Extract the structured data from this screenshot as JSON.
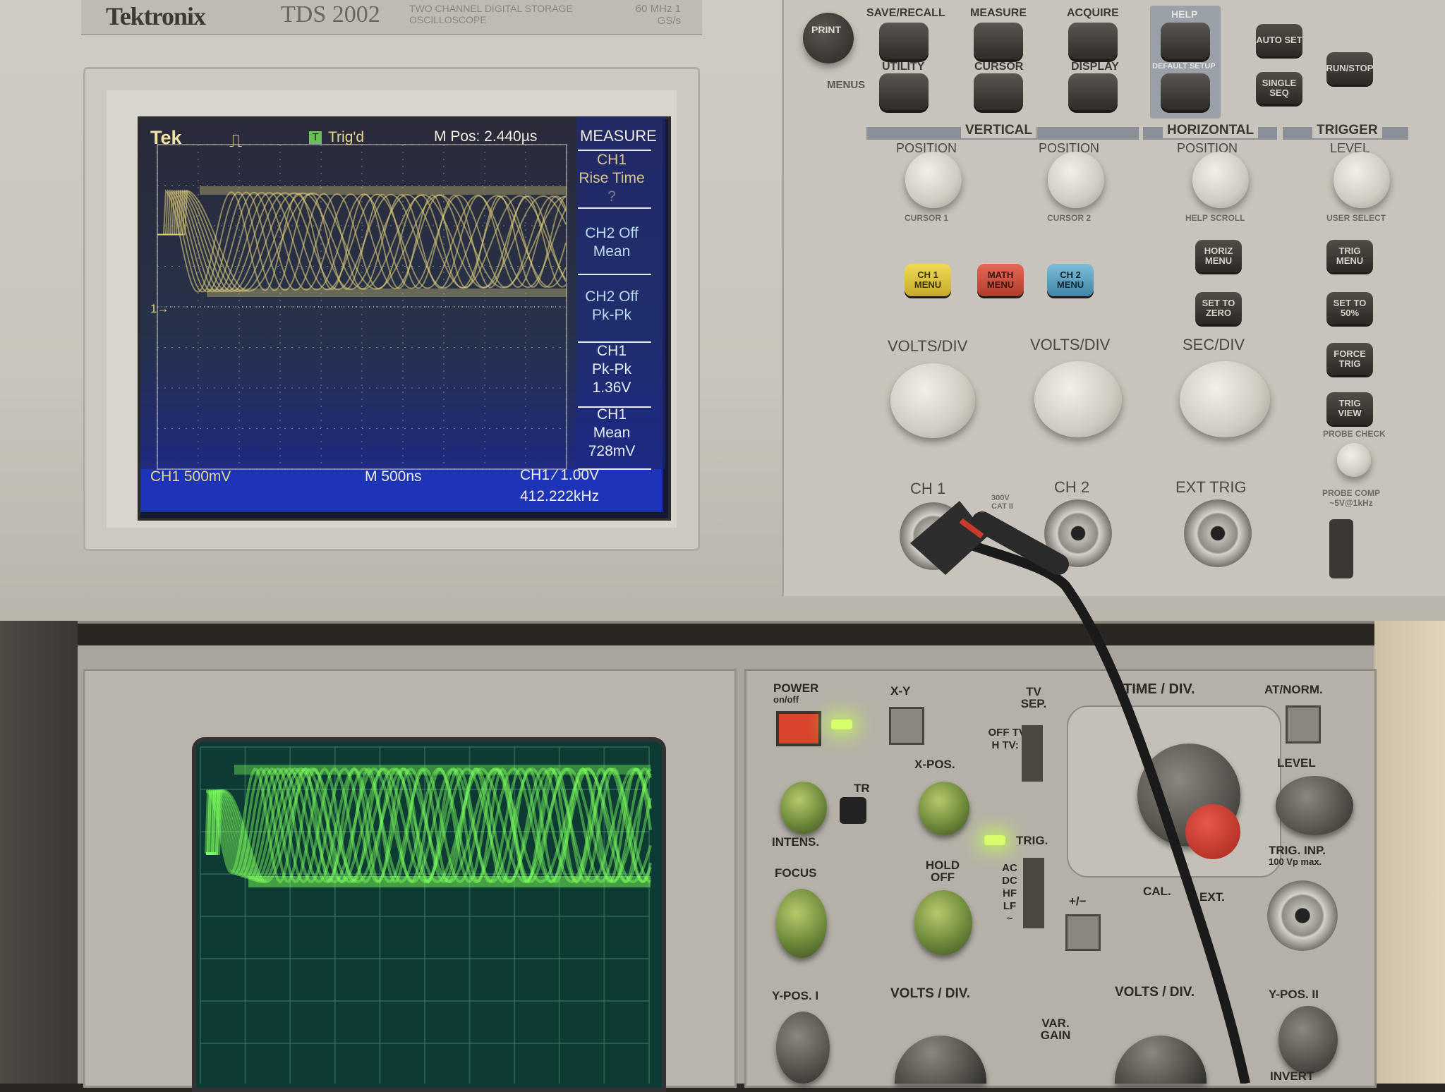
{
  "tds": {
    "brand": "Tektronix",
    "model": "TDS 2002",
    "model_desc": "TWO CHANNEL DIGITAL STORAGE OSCILLOSCOPE",
    "bandwidth": "60 MHz 1 GS/s"
  },
  "lcd": {
    "tek": "Tek",
    "trig_state": "Trig'd",
    "trig_icon": "T",
    "mpos": "M Pos: 2.440µs",
    "ch1_scale": "CH1  500mV",
    "timebase": "M 500ns",
    "trigger": "CH1 ∕ 1.00V",
    "frequency": "412.222kHz",
    "marker": "1→",
    "menu": {
      "title": "MEASURE",
      "slots": [
        {
          "l1": "CH1",
          "l2": "Rise Time",
          "l3": "?"
        },
        {
          "l1": "CH2 Off",
          "l2": "Mean",
          "l3": ""
        },
        {
          "l1": "CH2 Off",
          "l2": "Pk-Pk",
          "l3": ""
        },
        {
          "l1": "CH1",
          "l2": "Pk-Pk",
          "l3": "1.36V"
        },
        {
          "l1": "CH1",
          "l2": "Mean",
          "l3": "728mV"
        }
      ]
    },
    "trace_color": "#e2d27a",
    "screen_bg": "#141832"
  },
  "panel": {
    "print": "PRINT",
    "menus": "MENUS",
    "top_labels": [
      "SAVE/RECALL",
      "MEASURE",
      "ACQUIRE",
      "HELP"
    ],
    "mid_labels": [
      "UTILITY",
      "CURSOR",
      "DISPLAY",
      "DEFAULT SETUP"
    ],
    "autoset": "AUTO SET",
    "run_stop": "RUN/STOP",
    "single_seq": "SINGLE SEQ",
    "sections": [
      "VERTICAL",
      "HORIZONTAL",
      "TRIGGER"
    ],
    "position": "POSITION",
    "level": "LEVEL",
    "cursor1": "CURSOR 1",
    "cursor2": "CURSOR 2",
    "help_scroll": "HELP SCROLL",
    "user_select": "USER SELECT",
    "ch1_menu": "CH 1 MENU",
    "math_menu": "MATH MENU",
    "ch2_menu": "CH 2 MENU",
    "horiz_menu": "HORIZ MENU",
    "set_to_zero": "SET TO ZERO",
    "trig_menu": "TRIG MENU",
    "set_to_50": "SET TO 50%",
    "force_trig": "FORCE TRIG",
    "trig_view": "TRIG VIEW",
    "probe_check": "PROBE CHECK",
    "probe_comp": "PROBE COMP ~5V@1kHz",
    "volts_div": "VOLTS/DIV",
    "sec_div": "SEC/DIV",
    "ch1": "CH 1",
    "ch2": "CH 2",
    "ext_trig": "EXT TRIG",
    "cat": "300V CAT II",
    "ch1_color": "#e8cf3a",
    "math_color": "#d9533f",
    "ch2_color": "#5fa6c8"
  },
  "analog": {
    "power": "POWER",
    "on_off": "on/off",
    "xy": "X-Y",
    "tr": "TR",
    "intens": "INTENS.",
    "focus": "FOCUS",
    "xpos": "X-POS.",
    "tv_sep": "TV SEP.",
    "tv_modes": "OFF TV: H TV: V",
    "trig": "TRIG.",
    "coupling": "AC DC HF LF ~",
    "hold_off": "HOLD OFF",
    "time_div": "TIME / DIV.",
    "at_norm": "AT/NORM.",
    "level": "LEVEL",
    "trig_inp": "TRIG. INP.",
    "trig_inp_max": "100 Vp max.",
    "cal": "CAL.",
    "ext": "EXT.",
    "plus_minus": "+/−",
    "ypos1": "Y-POS. I",
    "ypos2": "Y-POS. II",
    "volts_div": "VOLTS / DIV.",
    "var_gain": "VAR. GAIN",
    "invert": "INVERT",
    "trace_color": "#7dff5a"
  }
}
